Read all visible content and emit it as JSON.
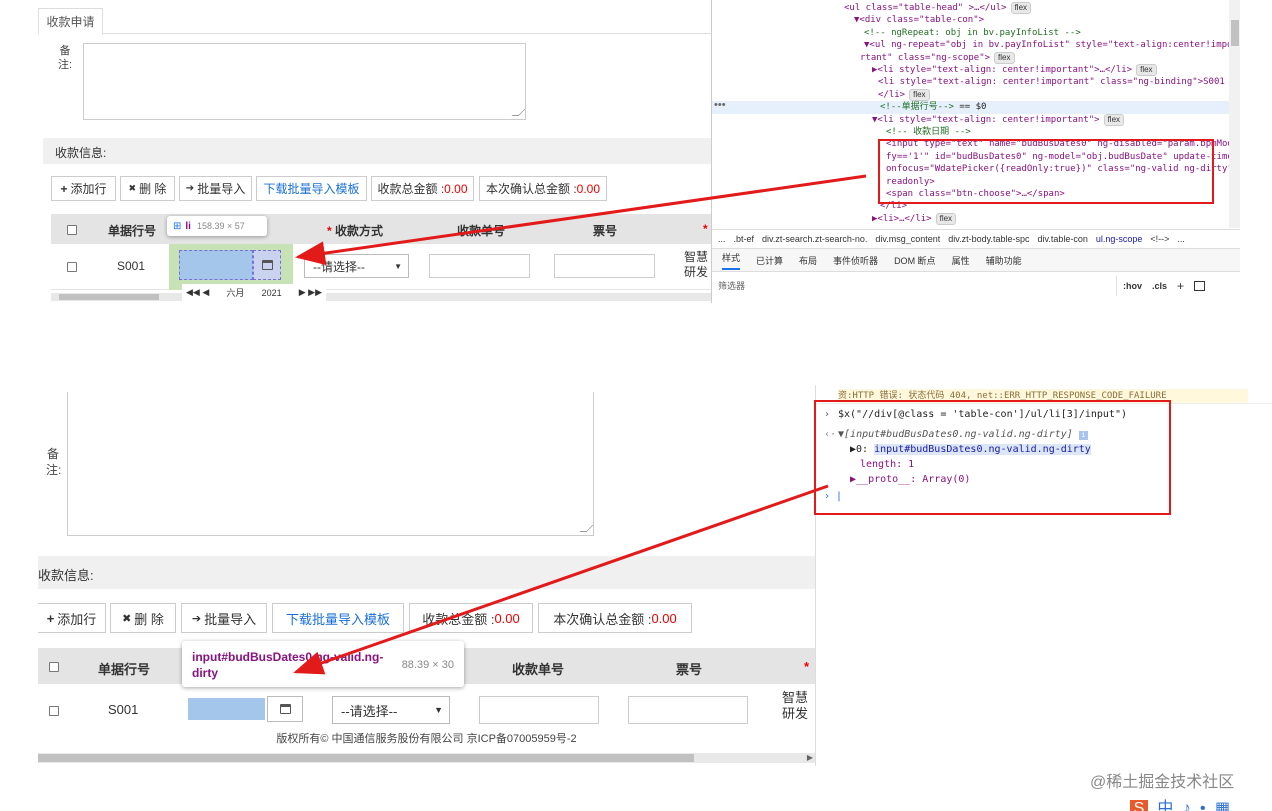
{
  "top_app": {
    "tab_label": "收款申请",
    "remark_label": "备\n注:",
    "section_title": "收款信息:",
    "buttons": {
      "add_row": "添加行",
      "add_row_icon": "+",
      "delete": "删 除",
      "delete_icon": "✖",
      "batch_import": "批量导入",
      "batch_import_icon": "➔",
      "download_template": "下载批量导入模板"
    },
    "total_amount_label": "收款总金额 : ",
    "total_amount_value": "0.00",
    "confirm_amount_label": "本次确认总金额 : ",
    "confirm_amount_value": "0.00",
    "table": {
      "headers": [
        "单据行号",
        "收款方式",
        "收款单号",
        "票号"
      ],
      "required_mark": "*",
      "row": {
        "line_no": "S001",
        "payment_select": "--请选择--",
        "right_text_1": "智慧",
        "right_text_2": "研发"
      }
    },
    "element_tooltip": {
      "tag": "li",
      "size": "158.39 × 57"
    },
    "datepicker_footer": {
      "month": "六月",
      "year": "2021"
    }
  },
  "devtools_top": {
    "code_lines": [
      {
        "parts": [
          [
            "t",
            "<ul class=\"table-head\" >…</ul>"
          ]
        ],
        "badge": "flex"
      },
      {
        "parts": [
          [
            "t",
            "▼<div class=\"table-con\">"
          ]
        ]
      },
      {
        "parts": [
          [
            "c",
            "<!-- ngRepeat: obj in  bv.payInfoList -->"
          ]
        ]
      },
      {
        "parts": [
          [
            "t",
            "▼<ul ng-repeat=\"obj in  bv.payInfoList\" style=\"text-align:center!impo"
          ]
        ]
      },
      {
        "parts": [
          [
            "t",
            "rtant\" class=\"ng-scope\">"
          ]
        ],
        "badge": "flex"
      },
      {
        "parts": [
          [
            "t",
            "▶<li style=\"text-align: center!important\">…</li>"
          ]
        ],
        "badge": "flex"
      },
      {
        "parts": [
          [
            "t",
            "<li style=\"text-align: center!important\" class=\"ng-binding\">S001"
          ]
        ]
      },
      {
        "parts": [
          [
            "t",
            "</li>"
          ]
        ],
        "badge": "flex"
      },
      {
        "parts": [
          [
            "c",
            "<!--单据行号-->"
          ],
          [
            "x",
            " == $0"
          ]
        ]
      },
      {
        "parts": [
          [
            "t",
            "▼<li style=\"text-align: center!important\">"
          ]
        ],
        "badge": "flex"
      },
      {
        "parts": [
          [
            "c",
            "<!-- 收款日期 -->"
          ]
        ]
      },
      {
        "parts": [
          [
            "t",
            "<input type=\"text\" name=\"budBusDates0\" ng-disabled=\"param.bpmModi"
          ]
        ]
      },
      {
        "parts": [
          [
            "t",
            "fy=='1'\" id=\"budBusDates0\" ng-model=\"obj.budBusDate\" update-time"
          ]
        ]
      },
      {
        "parts": [
          [
            "t",
            "onfocus=\"WdatePicker({readOnly:true})\" class=\"ng-valid ng-dirty\""
          ]
        ]
      },
      {
        "parts": [
          [
            "t",
            "readonly>"
          ]
        ]
      },
      {
        "parts": [
          [
            "t",
            "<span class=\"btn-choose\">…</span>"
          ]
        ]
      },
      {
        "parts": [
          [
            "t",
            "</li>"
          ]
        ]
      },
      {
        "parts": [
          [
            "t",
            "▶<li>…</li>"
          ]
        ],
        "badge": "flex"
      }
    ],
    "breadcrumbs": [
      "...",
      ".bt-ef",
      "div.zt-search.zt-search-no.",
      "div.msg_content",
      "div.zt-body.table-spc",
      "div.table-con",
      "ul.ng-scope",
      "<!-->",
      "..."
    ],
    "tabs": [
      "样式",
      "已计算",
      "布局",
      "事件侦听器",
      "DOM 断点",
      "属性",
      "辅助功能"
    ],
    "filter_placeholder": "筛选器",
    "filter_tools": [
      ":hov",
      ".cls",
      "+"
    ]
  },
  "bottom_app": {
    "remark_label": "备\n注:",
    "section_title": "收款信息:",
    "buttons": {
      "add_row": "添加行",
      "delete": "删 除",
      "batch_import": "批量导入",
      "download_template": "下载批量导入模板"
    },
    "total_amount_label": "收款总金额 : ",
    "total_amount_value": "0.00",
    "confirm_amount_label": "本次确认总金额 : ",
    "confirm_amount_value": "0.00",
    "headers": [
      "单据行号",
      "收款单号",
      "票号"
    ],
    "required_mark": "*",
    "row": {
      "line_no": "S001",
      "payment_select": "--请选择--",
      "right_text_1": "智慧",
      "right_text_2": "研发"
    },
    "footer": "版权所有© 中国通信服务股份有限公司 京ICP备07005959号-2",
    "tooltip": {
      "selector_1": "input#budBusDates0.ng-valid.ng-",
      "selector_2": "dirty",
      "size": "88.39 × 30"
    }
  },
  "console": {
    "error_line": "资:HTTP 错误: 状态代码 404, net::ERR_HTTP_RESPONSE_CODE_FAILURE",
    "command": "$x(\"//div[@class = 'table-con']/ul/li[3]/input\")",
    "result": "[input#budBusDates0.ng-valid.ng-dirty]",
    "item_0_key": "0: ",
    "item_0_val": "input#budBusDates0.ng-valid.ng-dirty",
    "length_line": "length: 1",
    "proto_line": "__proto__: Array(0)"
  },
  "watermark": "@稀土掘金技术社区",
  "bottom_icons": [
    "S",
    "中",
    "♪",
    "•",
    "▦"
  ],
  "colors": {
    "annotation_red": "#e31a1a",
    "selected_input_blue": "#a4c6ea",
    "amount_red": "#ee0000",
    "link_blue": "#1a6fd6"
  }
}
